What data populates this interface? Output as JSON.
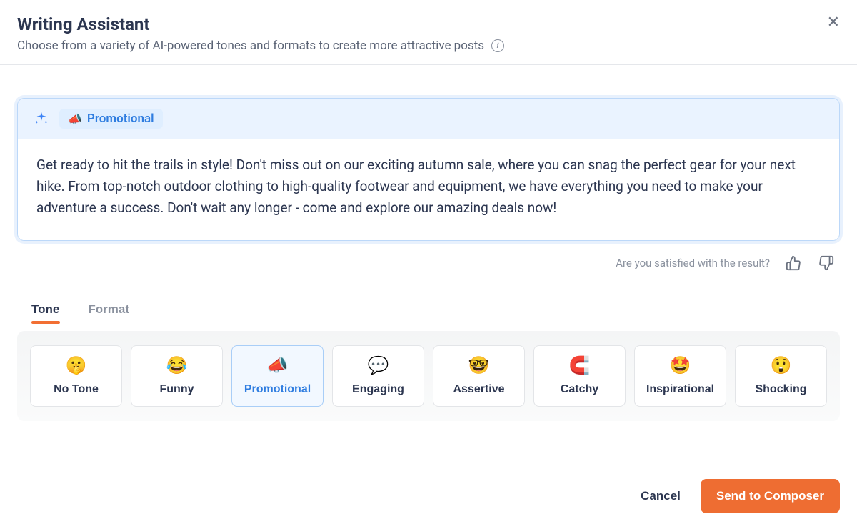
{
  "header": {
    "title": "Writing Assistant",
    "subtitle": "Choose from a variety of AI-powered tones and formats to create more attractive posts"
  },
  "card": {
    "badge_emoji": "📣",
    "badge_text": "Promotional",
    "text": "Get ready to hit the trails in style! Don't miss out on our exciting autumn sale, where you can snag the perfect gear for your next hike. From top-notch outdoor clothing to high-quality footwear and equipment, we have everything you need to make your adventure a success. Don't wait any longer - come and explore our amazing deals now!"
  },
  "feedback": {
    "label": "Are you satisfied with the result?"
  },
  "tabs": {
    "tone": "Tone",
    "format": "Format",
    "active": "tone"
  },
  "tones": [
    {
      "emoji": "🤫",
      "label": "No Tone",
      "selected": false
    },
    {
      "emoji": "😂",
      "label": "Funny",
      "selected": false
    },
    {
      "emoji": "📣",
      "label": "Promotional",
      "selected": true
    },
    {
      "emoji": "💬",
      "label": "Engaging",
      "selected": false
    },
    {
      "emoji": "🤓",
      "label": "Assertive",
      "selected": false
    },
    {
      "emoji": "🧲",
      "label": "Catchy",
      "selected": false
    },
    {
      "emoji": "🤩",
      "label": "Inspirational",
      "selected": false
    },
    {
      "emoji": "😲",
      "label": "Shocking",
      "selected": false
    }
  ],
  "footer": {
    "cancel": "Cancel",
    "send": "Send to Composer"
  }
}
